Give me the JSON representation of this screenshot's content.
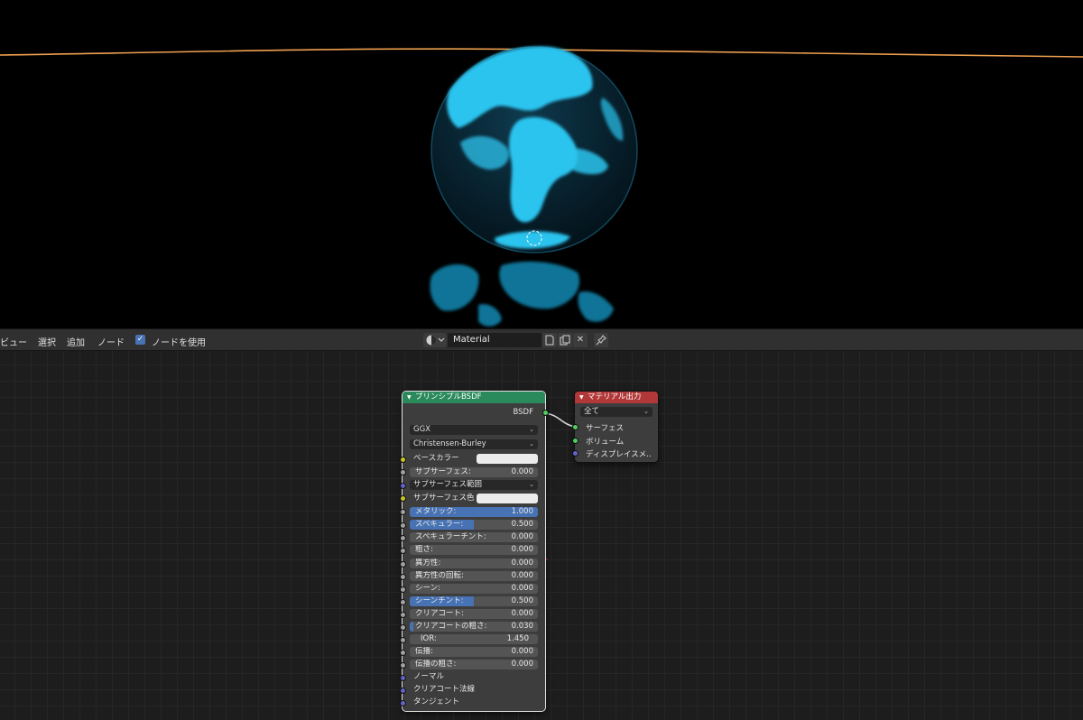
{
  "header": {
    "menus": [
      "ビュー",
      "選択",
      "追加",
      "ノード"
    ],
    "use_nodes_label": "ノードを使用",
    "material_name": "Material",
    "check_glyph": "✓",
    "close_glyph": "✕"
  },
  "bsdf_node": {
    "title": "プリンシプルBSDF",
    "output_label": "BSDF",
    "distribution": "GGX",
    "subsurface_method": "Christensen-Burley",
    "base_color_label": "ベースカラー",
    "subsurface_label": "サブサーフェス:",
    "subsurface_value": "0.000",
    "subsurface_radius_label": "サブサーフェス範囲",
    "subsurface_color_label": "サブサーフェス色",
    "metallic_label": "メタリック:",
    "metallic_value": "1.000",
    "specular_label": "スペキュラー:",
    "specular_value": "0.500",
    "specular_tint_label": "スペキュラーチント:",
    "specular_tint_value": "0.000",
    "roughness_label": "粗さ:",
    "roughness_value": "0.000",
    "anisotropic_label": "異方性:",
    "anisotropic_value": "0.000",
    "anisotropic_rotation_label": "異方性の回転:",
    "anisotropic_rotation_value": "0.000",
    "sheen_label": "シーン:",
    "sheen_value": "0.000",
    "sheen_tint_label": "シーンチント:",
    "sheen_tint_value": "0.500",
    "clearcoat_label": "クリアコート:",
    "clearcoat_value": "0.000",
    "clearcoat_roughness_label": "クリアコートの粗さ:",
    "clearcoat_roughness_value": "0.030",
    "ior_label": "IOR:",
    "ior_value": "1.450",
    "transmission_label": "伝播:",
    "transmission_value": "0.000",
    "transmission_roughness_label": "伝播の粗さ:",
    "transmission_roughness_value": "0.000",
    "normal_label": "ノーマル",
    "clearcoat_normal_label": "クリアコート法線",
    "tangent_label": "タンジェント",
    "metallic_fraction": 1.0,
    "specular_fraction": 0.5,
    "sheen_tint_fraction": 0.5,
    "clearcoat_roughness_fraction": 0.03
  },
  "output_node": {
    "title": "マテリアル出力",
    "target": "全て",
    "surface_label": "サーフェス",
    "volume_label": "ボリューム",
    "displacement_label": "ディスプレイスメ.."
  },
  "colors": {
    "accent_blue": "#4772b3",
    "bsdf_header": "#2b8a5c",
    "output_header": "#b13838",
    "selected_outline": "#e1e1e1",
    "globe_cyan": "#1fb6e8",
    "horizon_orange": "#f0a050"
  }
}
